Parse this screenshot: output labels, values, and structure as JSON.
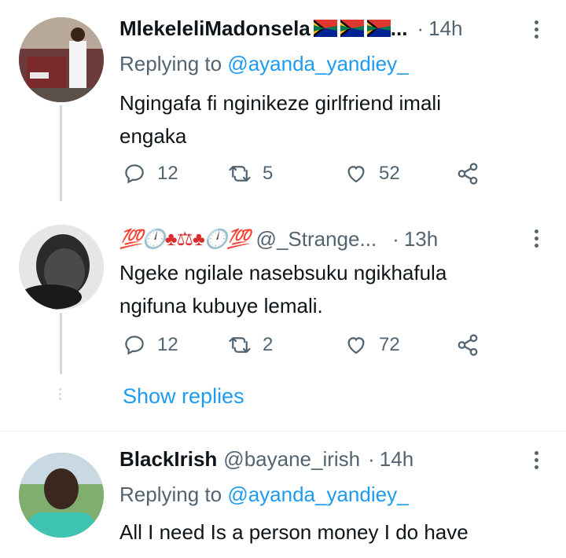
{
  "tweets": [
    {
      "name": "MlekeleliMadonsela",
      "name_suffix": "...",
      "handle": "",
      "separator": "·",
      "time": "14h",
      "replying_prefix": "Replying to",
      "replying_mention": "@ayanda_yandiey_",
      "lines": [
        "Ngingafa fi nginikeze girlfriend imali",
        "engaka"
      ],
      "replies": "12",
      "retweets": "5",
      "likes": "52"
    },
    {
      "name_emoji": "💯🕛♣⚖♣🕛💯",
      "handle": "@_Strange...",
      "separator": "·",
      "time": "13h",
      "lines": [
        "Ngeke ngilale nasebsuku ngikhafula",
        "ngifuna kubuye lemali."
      ],
      "replies": "12",
      "retweets": "2",
      "likes": "72"
    },
    {
      "name": "BlackIrish",
      "handle": "@bayane_irish",
      "separator": "·",
      "time": "14h",
      "replying_prefix": "Replying to",
      "replying_mention": "@ayanda_yandiey_",
      "lines": [
        "All I need Is a person money I do have"
      ]
    }
  ],
  "show_replies": "Show replies",
  "colors": {
    "accent": "#1d9bf0",
    "secondary": "#536471",
    "line": "#cfd9de"
  },
  "icons": [
    "reply-icon",
    "retweet-icon",
    "like-icon",
    "share-icon",
    "more-icon"
  ]
}
